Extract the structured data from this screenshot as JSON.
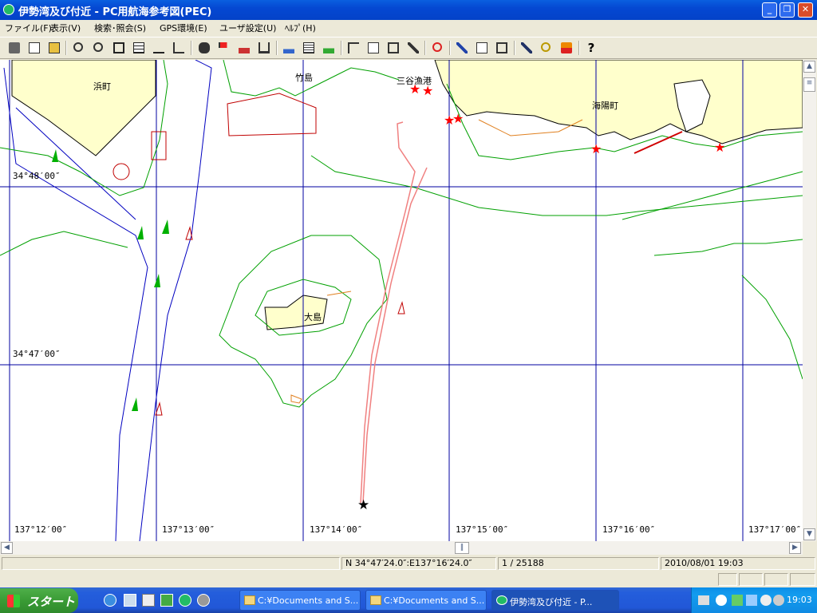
{
  "window": {
    "title": "伊勢湾及び付近 - PC用航海参考図(PEC)",
    "min_label": "_",
    "max_label": "❐",
    "close_label": "✕"
  },
  "menu": [
    {
      "label": "ファイル(F)"
    },
    {
      "label": "表示(V)"
    },
    {
      "label": "検索･照会(S)"
    },
    {
      "label": "GPS環境(E)"
    },
    {
      "label": "ユーザ設定(U)"
    },
    {
      "label": "ﾍﾙﾌﾟ(H)"
    }
  ],
  "toolbar": {
    "icons": [
      "print-icon",
      "print-preview-icon",
      "fax-icon",
      "zoom-in-icon",
      "zoom-out-icon",
      "fit-icon",
      "grid-icon",
      "ruler-icon",
      "measure-icon",
      "binoculars-icon",
      "flag-icon",
      "ship-icon",
      "port-icon",
      "compass-icon",
      "table-icon",
      "route-icon",
      "track-icon",
      "annotate-icon",
      "zoom-window-icon",
      "pen-icon",
      "pin-icon",
      "edit-icon",
      "comment-icon",
      "magnifier-icon",
      "draw-icon",
      "search-icon",
      "download-icon",
      "help-icon"
    ],
    "help_label": "?"
  },
  "map": {
    "labels": {
      "hamacho": "浜町",
      "takeshima": "竹島",
      "miya_port": "三谷漁港",
      "kaiyocho": "海陽町",
      "ooshima": "大島"
    },
    "lat_labels": [
      "34°48′00″",
      "34°47′00″"
    ],
    "lon_labels": [
      "137°12′00″",
      "137°13′00″",
      "137°14′00″",
      "137°15′00″",
      "137°16′00″",
      "137°17′00″"
    ],
    "colors": {
      "land": "#FFFFCC",
      "grid": "#0000A0",
      "contour": "#00A000",
      "track": "#F08080",
      "marker": "#FF0000",
      "channel": "#0000C0"
    }
  },
  "status": {
    "position": "N 34°47′24.0″:E137°16′24.0″",
    "scale": "1 / 25188",
    "datetime": "2010/08/01 19:03"
  },
  "taskbar": {
    "start_label": "スタート",
    "tasks": [
      {
        "label": "C:¥Documents and S..."
      },
      {
        "label": "C:¥Documents and S..."
      },
      {
        "label": "伊勢湾及び付近 - P..."
      }
    ],
    "clock": "19:03"
  }
}
